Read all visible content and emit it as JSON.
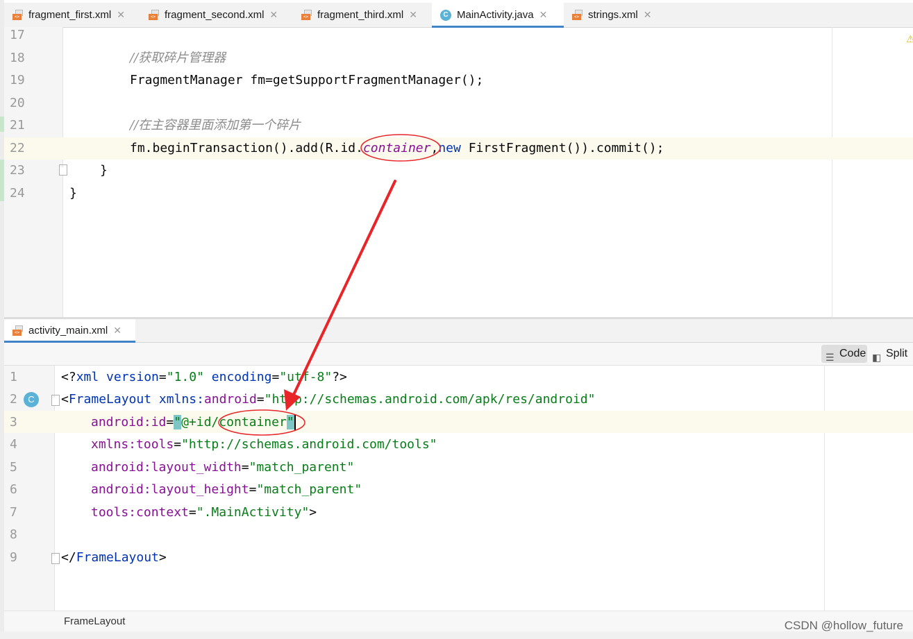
{
  "top_tabs": [
    {
      "label": "fragment_first.xml",
      "icon": "xml-file-icon"
    },
    {
      "label": "fragment_second.xml",
      "icon": "xml-file-icon"
    },
    {
      "label": "fragment_third.xml",
      "icon": "xml-file-icon"
    },
    {
      "label": "MainActivity.java",
      "icon": "java-class-icon",
      "active": true
    },
    {
      "label": "strings.xml",
      "icon": "xml-file-icon"
    }
  ],
  "java_editor": {
    "line_numbers": [
      "17",
      "18",
      "19",
      "20",
      "21",
      "22",
      "23",
      "24"
    ],
    "lines": {
      "l18_comment": "//获取碎片管理器",
      "l19_code": "FragmentManager fm=getSupportFragmentManager();",
      "l21_comment": "//在主容器里面添加第一个碎片",
      "l22_a": "fm.beginTransaction().add(R.id.",
      "l22_field": "container",
      "l22_b": ",",
      "l22_kw": "new",
      "l22_c": " FirstFragment()).commit();",
      "l23": "}",
      "l24": "}"
    }
  },
  "bottom_tab": {
    "label": "activity_main.xml"
  },
  "mode_buttons": {
    "code": "Code",
    "split": "Split"
  },
  "xml_editor": {
    "line_numbers": [
      "1",
      "2",
      "3",
      "4",
      "5",
      "6",
      "7",
      "8",
      "9"
    ],
    "class_badge": "C",
    "l1": {
      "open": "<?",
      "tag": "xml",
      "a1": " version",
      "eq1": "=",
      "v1": "\"1.0\"",
      "a2": " encoding",
      "eq2": "=",
      "v2": "\"utf-8\"",
      "close": "?>"
    },
    "l2": {
      "open": "<",
      "tag": "FrameLayout",
      "ns": " xmlns:",
      "attr": "android",
      "eq": "=",
      "val": "\"http://schemas.android.com/apk/res/android\""
    },
    "l3": {
      "ns": "android:",
      "attr": "id",
      "eq": "=",
      "q1": "\"",
      "val1": "@+id/",
      "val2": "container",
      "q2": "\""
    },
    "l4": {
      "ns": "xmlns:",
      "attr": "tools",
      "eq": "=",
      "val": "\"http://schemas.android.com/tools\""
    },
    "l5": {
      "ns": "android:",
      "attr": "layout_width",
      "eq": "=",
      "val": "\"match_parent\""
    },
    "l6": {
      "ns": "android:",
      "attr": "layout_height",
      "eq": "=",
      "val": "\"match_parent\""
    },
    "l7": {
      "ns": "tools:",
      "attr": "context",
      "eq": "=",
      "val": "\".MainActivity\"",
      "close": ">"
    },
    "l9": {
      "open": "</",
      "tag": "FrameLayout",
      "close": ">"
    }
  },
  "breadcrumb": "FrameLayout",
  "watermark": "CSDN @hollow_future",
  "colors": {
    "annotation": "#e8262a",
    "tab_underline": "#4083c9",
    "line_highlight": "#fcfaed"
  }
}
